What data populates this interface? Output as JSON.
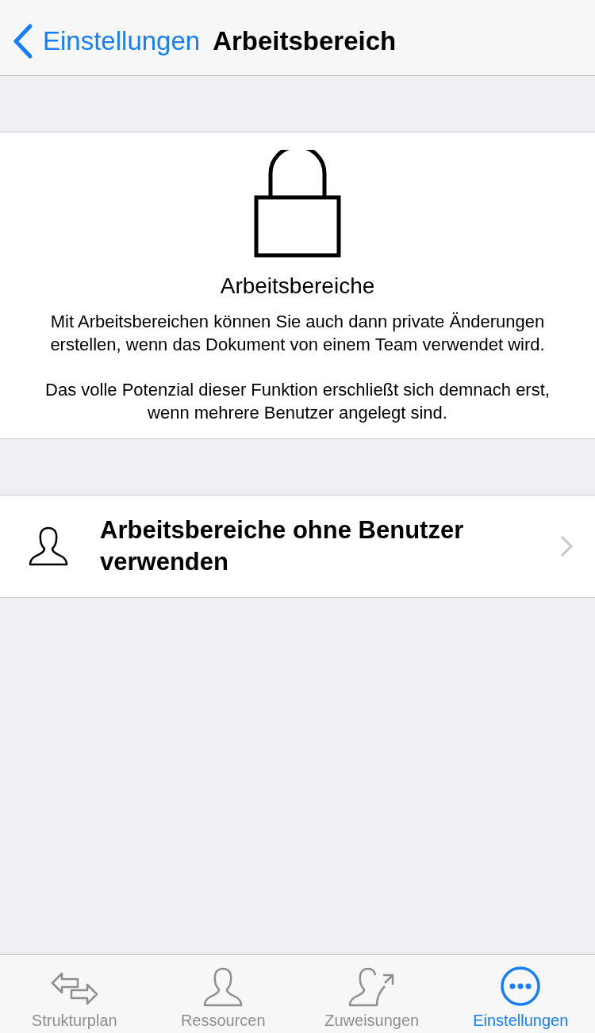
{
  "nav": {
    "back": "Einstellungen",
    "title": "Arbeitsbereich"
  },
  "info": {
    "heading": "Arbeitsbereiche",
    "paragraphs": [
      "Mit Arbeitsbereichen können Sie auch dann private Änderungen erstellen, wenn das Dokument von einem Team verwendet wird.",
      "Das volle Potenzial dieser Funktion erschließt sich demnach erst, wenn mehrere Benutzer angelegt sind."
    ]
  },
  "row": {
    "label": "Arbeitsbereiche ohne Benutzer verwenden"
  },
  "tabs": [
    {
      "label": "Strukturplan",
      "kind": "arrows",
      "selected": false
    },
    {
      "label": "Ressourcen",
      "kind": "person",
      "selected": false
    },
    {
      "label": "Zuweisungen",
      "kind": "assign",
      "selected": false
    },
    {
      "label": "Einstellungen",
      "kind": "more",
      "selected": true
    }
  ]
}
